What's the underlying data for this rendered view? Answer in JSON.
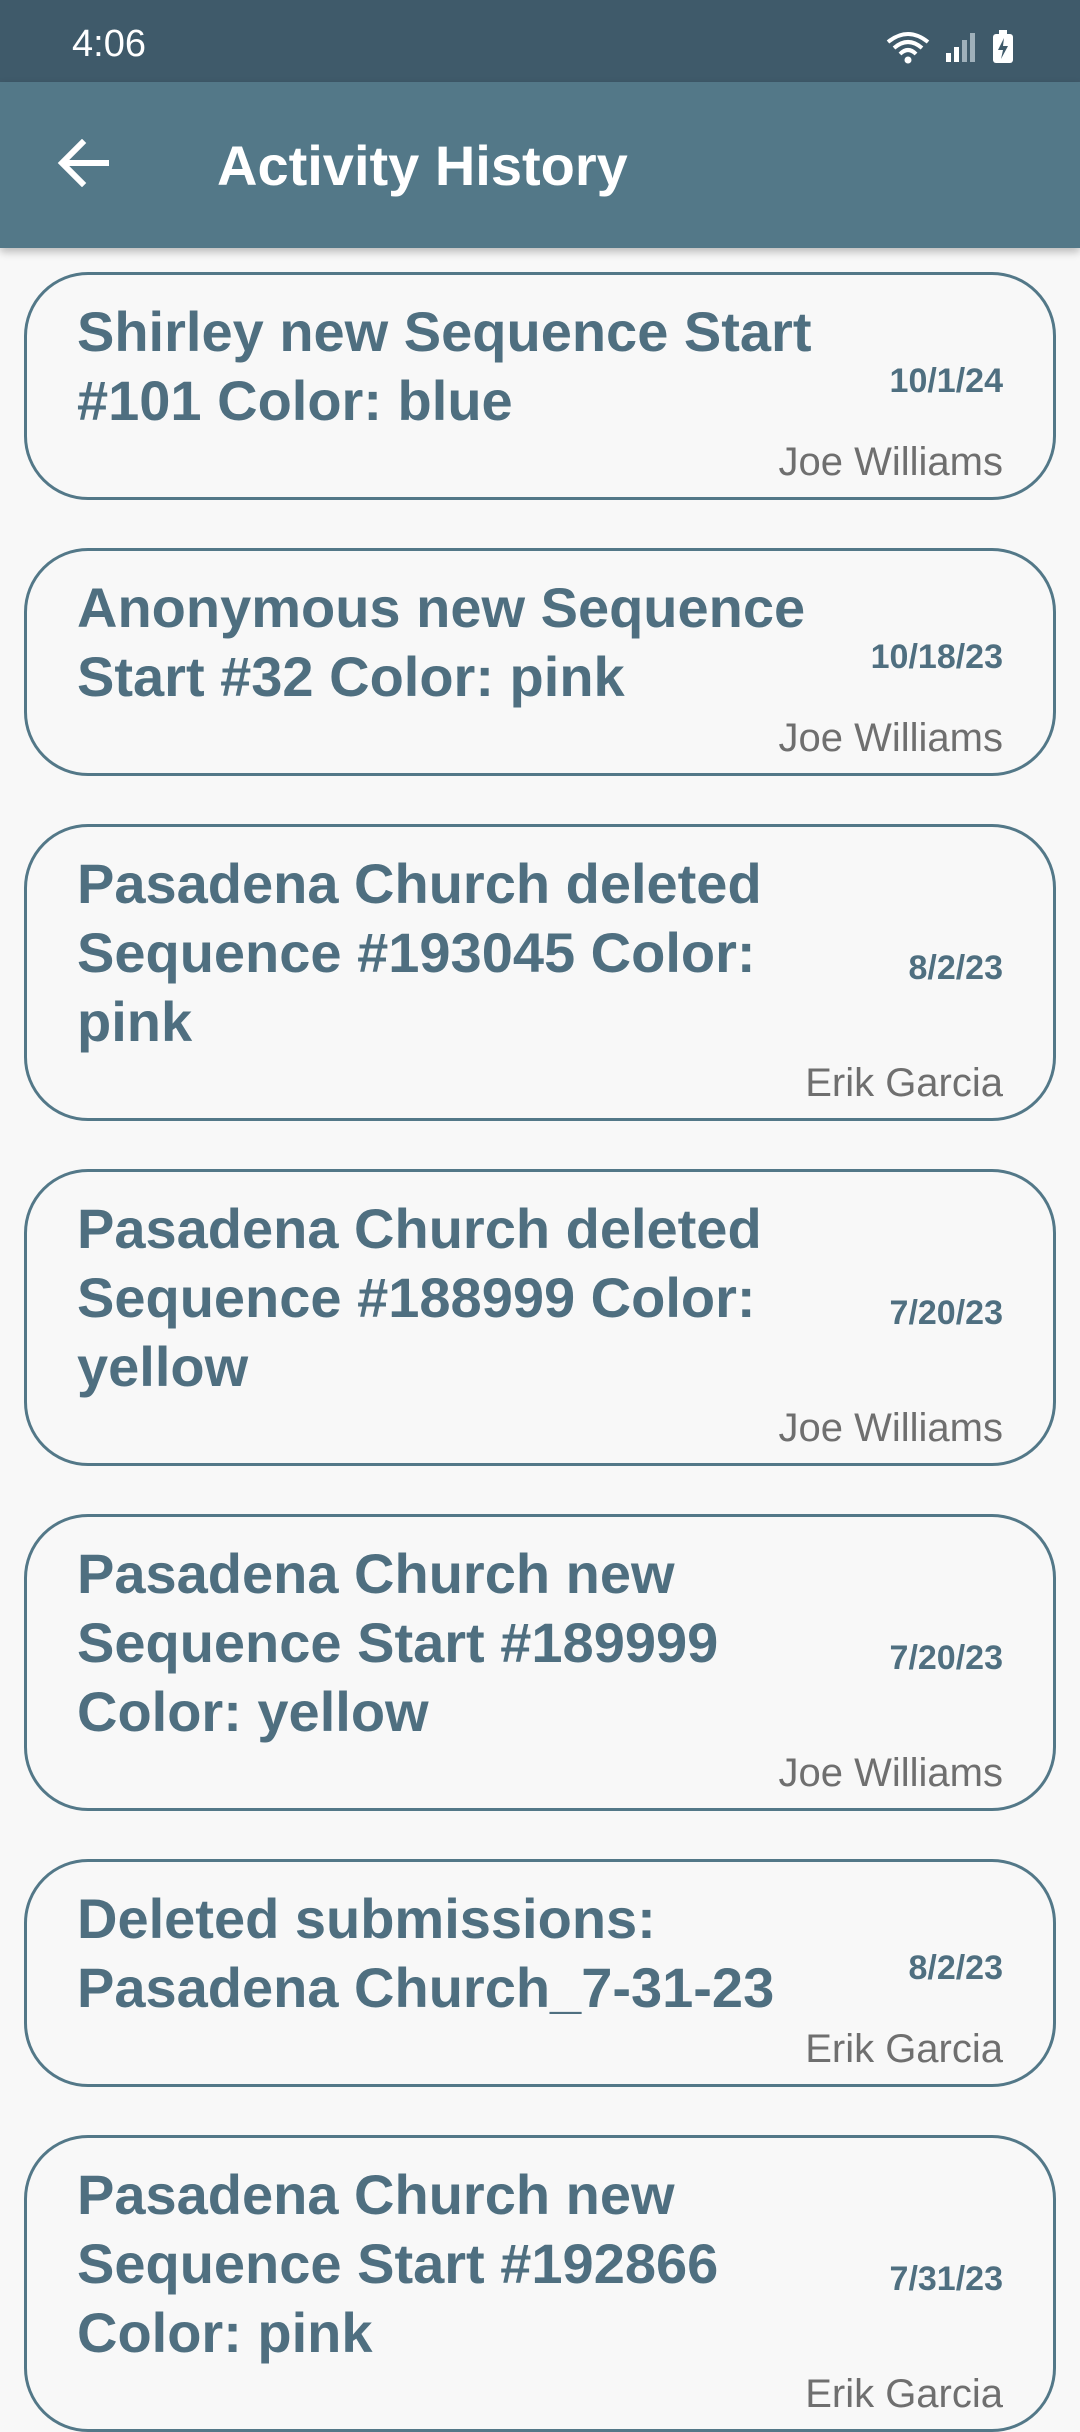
{
  "status_bar": {
    "time": "4:06",
    "icons": [
      "wifi-icon",
      "signal-icon",
      "battery-charging-icon"
    ]
  },
  "app_bar": {
    "back_icon": "arrow-left-icon",
    "title": "Activity History"
  },
  "colors": {
    "status_bar": "#3f5a6a",
    "app_bar": "#537888",
    "accent_text": "#4f6f80",
    "secondary_text": "#6f6f6f",
    "background": "#f8f8f8"
  },
  "activities": [
    {
      "title": "Shirley new Sequence Start #101 Color: blue",
      "date": "10/1/24",
      "user": "Joe Williams"
    },
    {
      "title": "Anonymous new Sequence Start #32 Color: pink",
      "date": "10/18/23",
      "user": "Joe Williams"
    },
    {
      "title": "Pasadena Church deleted Sequence #193045 Color: pink",
      "date": "8/2/23",
      "user": "Erik Garcia"
    },
    {
      "title": "Pasadena Church deleted Sequence #188999 Color: yellow",
      "date": "7/20/23",
      "user": "Joe Williams"
    },
    {
      "title": "Pasadena Church new Sequence Start #189999 Color: yellow",
      "date": "7/20/23",
      "user": "Joe Williams"
    },
    {
      "title": "Deleted submissions: Pasadena Church_7-31-23",
      "date": "8/2/23",
      "user": "Erik Garcia"
    },
    {
      "title": "Pasadena Church new Sequence Start #192866 Color: pink",
      "date": "7/31/23",
      "user": "Erik Garcia"
    }
  ]
}
